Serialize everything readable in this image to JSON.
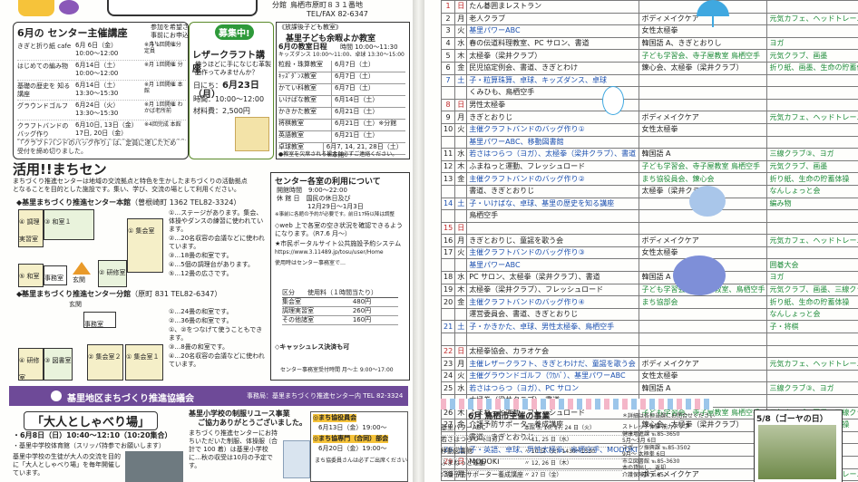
{
  "left": {
    "header": {
      "address": "鳥栖市原町８３１番地",
      "telfax": "TEL/FAX 82-6347",
      "bunsho": "分館"
    },
    "courses": {
      "title": "6月の センター主催講座",
      "note1": "参加を希望される方は",
      "note2": "事前にお申込みください。",
      "items": [
        {
          "name": "きぎと折り紙 cafe",
          "date": "6月 6日（金）",
          "time": "10:00～12:00",
          "cost": "※月 1回開催分 定員"
        },
        {
          "name": "はじめての編み物",
          "date": "6月14日（土）",
          "time": "10:00～12:00",
          "cost": "※月 1回開催 分"
        },
        {
          "name": "基礎の歴史を 知る講座",
          "date": "6月14日（土）",
          "time": "13:30～15:30",
          "cost": "※月 1回開催 本館"
        },
        {
          "name": "グラウンドゴルフ",
          "date": "6月24日（火）",
          "time": "13:30～15:30",
          "cost": "※月 1回開催 わかば老所前"
        },
        {
          "name": "クラフトバンドの バッグ作り",
          "date": "6月10日, 13日（金）",
          "time": "17日, 20日（金）",
          "time2": "13:30～15:30",
          "cost": "※4回完成 本館"
        }
      ],
      "footnote1": "「クラフトバンドのバッグ作り」は、定員に達したため",
      "footnote2": "受付を締め切りました。"
    },
    "recruit": {
      "badge": "募集中!",
      "title": "レザークラフト講座",
      "desc1": "使うほどに手になじむ革製品",
      "desc2": "を作ってみませんか？",
      "date_label": "日にち：",
      "date": "6月23日（月）",
      "time_label": "時間：",
      "time": "10:00～12:00",
      "fee_label": "材料費：",
      "fee": "2,500円"
    },
    "kids": {
      "tag": "《放課後子ども教室》",
      "title": "基里子ども余暇よか教室",
      "subtitle": "6月の教室日程",
      "time": "時間 10:00～11:30",
      "kids_time": "キッズダンス 10:00～11:00、卓球 13:30～15:00",
      "rows": [
        {
          "name": "粒殺・珠算教室",
          "date": "6月7日（土）"
        },
        {
          "name": "ｷｯｽﾞﾀﾞﾝｽ教室",
          "date": "6月7日（土）"
        },
        {
          "name": "かてい科教室",
          "date": "6月7日（土）"
        },
        {
          "name": "いけばな教室",
          "date": "6月14日（土）"
        },
        {
          "name": "かきかた教室",
          "date": "6月21日（土）"
        },
        {
          "name": "将棋教室",
          "date": "6月21日（土）※分館"
        },
        {
          "name": "英語教室",
          "date": "6月21日（土）"
        },
        {
          "name": "卓球教室",
          "date": "6月7, 14, 21, 28日（土）※本館"
        }
      ],
      "note": "●教室を欠席される場合は必ずご連絡ください。"
    },
    "katsuyo": {
      "title": "活用!!まちセン",
      "intro1": "まちづくり推進センターは地域の交流拠点と特色を生かしたまちづくりの活動拠点",
      "intro2": "となることを目的とした施設です。集い、学び、交流の場として利用ください。"
    },
    "honkan": {
      "title": "◆基里まちづくり推進センター本館",
      "addr": "（曽根崎町 1362 TEL82-3324）",
      "notes": [
        "①…ステージがあります。集会、体操やダンスの練習に使われています。",
        "②…20名収容の会議などに使われています。",
        "③…18畳の和室です。",
        "④…5個の調理台があります。",
        "⑤…12畳の広さです。"
      ],
      "rooms": [
        "④ 調理 実習室",
        "③ 和室１",
        "① 集会室",
        "⑤ 和室２",
        "事務室",
        "② 研修室",
        "玄関"
      ]
    },
    "bunkan": {
      "title": "◆基里まちづくり推進センター分館",
      "addr": "（原町 831 TEL82-6347）",
      "notes": [
        "①…24畳の和室です。",
        "②…36畳の和室です。",
        "①、②をつなげて使うこともできます。",
        "③…8畳の和室です。",
        "④…20名収容の会議などに使われています。"
      ],
      "rooms": [
        "玄関",
        "事務室",
        "④ 研修室",
        "③ 図書室",
        "② 集会室２",
        "① 集会室１"
      ]
    },
    "usage": {
      "title": "センター各室の利用について",
      "hours": "開館時間　9:00～22:00",
      "closed": "休 館 日　国民の休日及び",
      "closed2": "12月29日～1月3日",
      "reserve_note": "※事前に各館の予約が必要です。前日17時以降は調整",
      "web1": "◇web 上で各室の空き状況を確認できるようになります。（R7.6 月～）",
      "web2": "★市民ポータルサイト公共施設予約システム",
      "url": "https://www.3.11489.jp/tosu/user/Home",
      "web3": "使用時はセンター事務室で…",
      "fee_title": "区分　　使用料（１時間当たり）",
      "fees": [
        {
          "name": "集会室",
          "fee": "480円"
        },
        {
          "name": "調理実習室",
          "fee": "260円"
        },
        {
          "name": "その他諸室",
          "fee": "160円"
        }
      ],
      "cashless": "◇キャッシュレス決済も可",
      "office": "センター事務室受付時間 月～土 9:00～17:00"
    },
    "kyogikai": {
      "title": "基里地区まちづくり推進協議会",
      "office": "事務局：基里まちづくり推進センター内 TEL 82-3324"
    },
    "talk": {
      "title": "「大人としゃべり場」",
      "date": "・6月8日（日）10:40～12:10（10:20集合）",
      "place": "・基里中学校体育館（スリッパ持参でお願いします）",
      "desc": "基里中学校の生徒が大人の交流を目的に「大人としゃべり場」を毎年開催しています。"
    },
    "reuse": {
      "title": "基里小学校の制服リユース事業",
      "subtitle": "ご協力ありがとうございました。",
      "text": "まちづくり推進センターにお持ちいただいた制服、体操服（合計で 100 着）は基里小学校に…秋の収受は10月の予定です。"
    },
    "town": {
      "t1": "◎まち協役員会",
      "d1": "6月13日（金）19:00～",
      "t2": "◎まち協専門（合同）部会",
      "d2": "6月20日（金）19:00～",
      "note": "まち協委員さんは必ずご出席ください"
    }
  },
  "right": {
    "schedule": {
      "rows": [
        {
          "d": "1",
          "w": "日",
          "a": "たん碁囲まレストラン",
          "b": "",
          "c": ""
        },
        {
          "d": "2",
          "w": "月",
          "a": "老人クラブ",
          "b": "ボディメイクケア",
          "c": "元気カフェ、ヘッドトレーニング"
        },
        {
          "d": "3",
          "w": "火",
          "a": "基里パワーABC",
          "b": "女性太極拳",
          "c": ""
        },
        {
          "d": "4",
          "w": "水",
          "a": "春の伝道料理教室、PC サロン、書道",
          "b": "韓国語 A、きぎとおりし",
          "c": "ヨガ"
        },
        {
          "d": "5",
          "w": "木",
          "a": "太極拳（梁井クラブ）",
          "b": "子ども学習会、寺子屋教室 鳥栖空手",
          "c": "元気クラブ、画墨"
        },
        {
          "d": "6",
          "w": "金",
          "a": "民児協定例会、書道、きぎとわけ",
          "b": "錬心会、太極拳（梁井クラブ）",
          "c": "折り紙、画墨、生命の貯蓄体操 なんしょっと会"
        },
        {
          "d": "7",
          "w": "土",
          "a": "子・粒算珠算、卓球、キッズダンス、卓球",
          "b": "",
          "c": ""
        },
        {
          "d": "",
          "w": "",
          "a": "くみひも、鳥栖空手",
          "b": "",
          "c": ""
        },
        {
          "d": "8",
          "w": "日",
          "a": "男性太極拳",
          "b": "",
          "c": ""
        },
        {
          "d": "9",
          "w": "月",
          "a": "きぎとおりじ",
          "b": "ボディメイクケア",
          "c": "元気カフェ、ヘッドトレーニング"
        },
        {
          "d": "10",
          "w": "火",
          "a": "主催クラフトバンドのバッグ作り①",
          "b": "女性太極拳",
          "c": ""
        },
        {
          "d": "",
          "w": "",
          "a": "基里パワーABC、移動図書館",
          "b": "",
          "c": ""
        },
        {
          "d": "11",
          "w": "水",
          "a": "若さはつらつ（ヨガ）、太極拳（梁井クラブ）、書道",
          "b": "韓国語 A",
          "c": "三線クラブ③、ヨガ"
        },
        {
          "d": "12",
          "w": "木",
          "a": "ふまねっと運動、フレッシュロード",
          "b": "子ども学習会、寺子屋教室 鳥栖空手",
          "c": "元気クラブ、画墨"
        },
        {
          "d": "13",
          "w": "金",
          "a": "主催クラフトバンドのバッグ作り②",
          "b": "まち協役員会、錬心会",
          "c": "折り紙、生命の貯蓄体操"
        },
        {
          "d": "",
          "w": "",
          "a": "書道、きぎとおりじ",
          "b": "太極拳（梁井クラブ）",
          "c": "なんしょっと会"
        },
        {
          "d": "14",
          "w": "土",
          "a": "子・いけばな、卓球、基里の歴史を知る講座",
          "b": "",
          "c": "編み物"
        },
        {
          "d": "",
          "w": "",
          "a": "鳥栖空手",
          "b": "",
          "c": ""
        },
        {
          "d": "15",
          "w": "日",
          "a": "",
          "b": "",
          "c": ""
        },
        {
          "d": "16",
          "w": "月",
          "a": "きぎとおりじ、童謡を歌う会",
          "b": "ボディメイクケア",
          "c": "元気カフェ、ヘッドトレーニング"
        },
        {
          "d": "17",
          "w": "火",
          "a": "主催クラフトバンドのバッグ作り③",
          "b": "女性太極拳",
          "c": ""
        },
        {
          "d": "",
          "w": "",
          "a": "基里パワーABC",
          "b": "",
          "c": "囲碁大会"
        },
        {
          "d": "18",
          "w": "水",
          "a": "PC サロン、太極拳（梁井クラブ）、書道",
          "b": "韓国語 A",
          "c": "ヨガ"
        },
        {
          "d": "19",
          "w": "木",
          "a": "太極拳（梁井クラブ）、フレッシュロード",
          "b": "子ども学習会、寺子屋教室、鳥栖空手",
          "c": "元気クラブ、画墨、三線クラブ②"
        },
        {
          "d": "20",
          "w": "金",
          "a": "主催クラフトバンドのバッグ作り④",
          "b": "まち協部会",
          "c": "折り紙、生命の貯蓄体操"
        },
        {
          "d": "",
          "w": "",
          "a": "運営委員会、書道、きぎとおりじ",
          "b": "",
          "c": "なんしょっと会"
        },
        {
          "d": "21",
          "w": "土",
          "a": "子・かきかた、卓球、男性太極拳、鳥栖空手",
          "b": "",
          "c": "子・将棋"
        },
        {
          "d": "",
          "w": "",
          "a": "",
          "b": "",
          "c": ""
        },
        {
          "d": "22",
          "w": "日",
          "a": "太極拳協会、カラオケ会",
          "b": "",
          "c": ""
        },
        {
          "d": "23",
          "w": "月",
          "a": "主催レザークラフト、きぎとわけだ、童謡を歌う会",
          "b": "ボディメイクケア",
          "c": "元気カフェ、ヘッドトレーニング"
        },
        {
          "d": "24",
          "w": "火",
          "a": "主催グラウンドゴルフ（ﾜｶﾊﾞ）、基里パワーABC",
          "b": "女性太極拳",
          "c": ""
        },
        {
          "d": "25",
          "w": "水",
          "a": "若さはつらつ（ヨガ）、PC サロン",
          "b": "韓国語 A",
          "c": "三線クラブ③、ヨガ"
        },
        {
          "d": "",
          "w": "",
          "a": "太極拳（梁井クラブ）、書道",
          "b": "",
          "c": ""
        },
        {
          "d": "26",
          "w": "木",
          "a": "ふまねっと運動、フレッシュロード",
          "b": "子ども学習会、寺子屋教室 鳥栖空手",
          "c": "元気クラブ、画墨、三線クラブ②"
        },
        {
          "d": "27",
          "w": "金",
          "a": "介護予防サポーター養成講座",
          "b": "錬心会、太極拳（梁井クラブ）",
          "c": "折り紙、生命の貯蓄体操"
        },
        {
          "d": "",
          "w": "",
          "a": "書道、きぎとおりじ",
          "b": "",
          "c": "なんしょっと会"
        },
        {
          "d": "28",
          "w": "土",
          "a": "子・英語、卓球、男性太極拳、鳥栖空手、MODOKI",
          "b": "",
          "c": ""
        },
        {
          "d": "29",
          "w": "日",
          "a": "MODOKI",
          "b": "",
          "c": ""
        },
        {
          "d": "30",
          "w": "月",
          "a": "",
          "b": "ボディメイクケア",
          "c": "元気カフェ、ヘッドトレーニング"
        }
      ]
    },
    "city": {
      "title": "6月 鳥栖市主催の事業",
      "note": "＊詳細は各担当課にお問合せください",
      "rows": [
        {
          "name": "基里パワーABC",
          "when": "本館 3, 10, 17, 24 日（火）"
        },
        {
          "name": "若さはつらつ（ヨガ）",
          "when": "〃 11, 25 日（水）"
        },
        {
          "name": "移動図書館",
          "when": "〃 10 日（火）1430～1530"
        },
        {
          "name": "ふまねっと運動",
          "when": "〃 12, 26 日（木）"
        },
        {
          "name": "介護予防サポーター養成講座",
          "when": "〃 27 日（金）"
        }
      ],
      "contact": [
        "ストレッチ体操 筋力アップ",
        "健康増進課 ℡85-3650",
        "5月～3月 6日",
        "スポーツ振興課 ℡85-3502",
        "9月～ 太極拳 6日",
        "市立図書館 ℡85-3630",
        "本の貸出し、返却",
        "介護保険課 ℡85-"
      ]
    },
    "photo": {
      "title": "5/8（ゴーヤの日）"
    }
  }
}
